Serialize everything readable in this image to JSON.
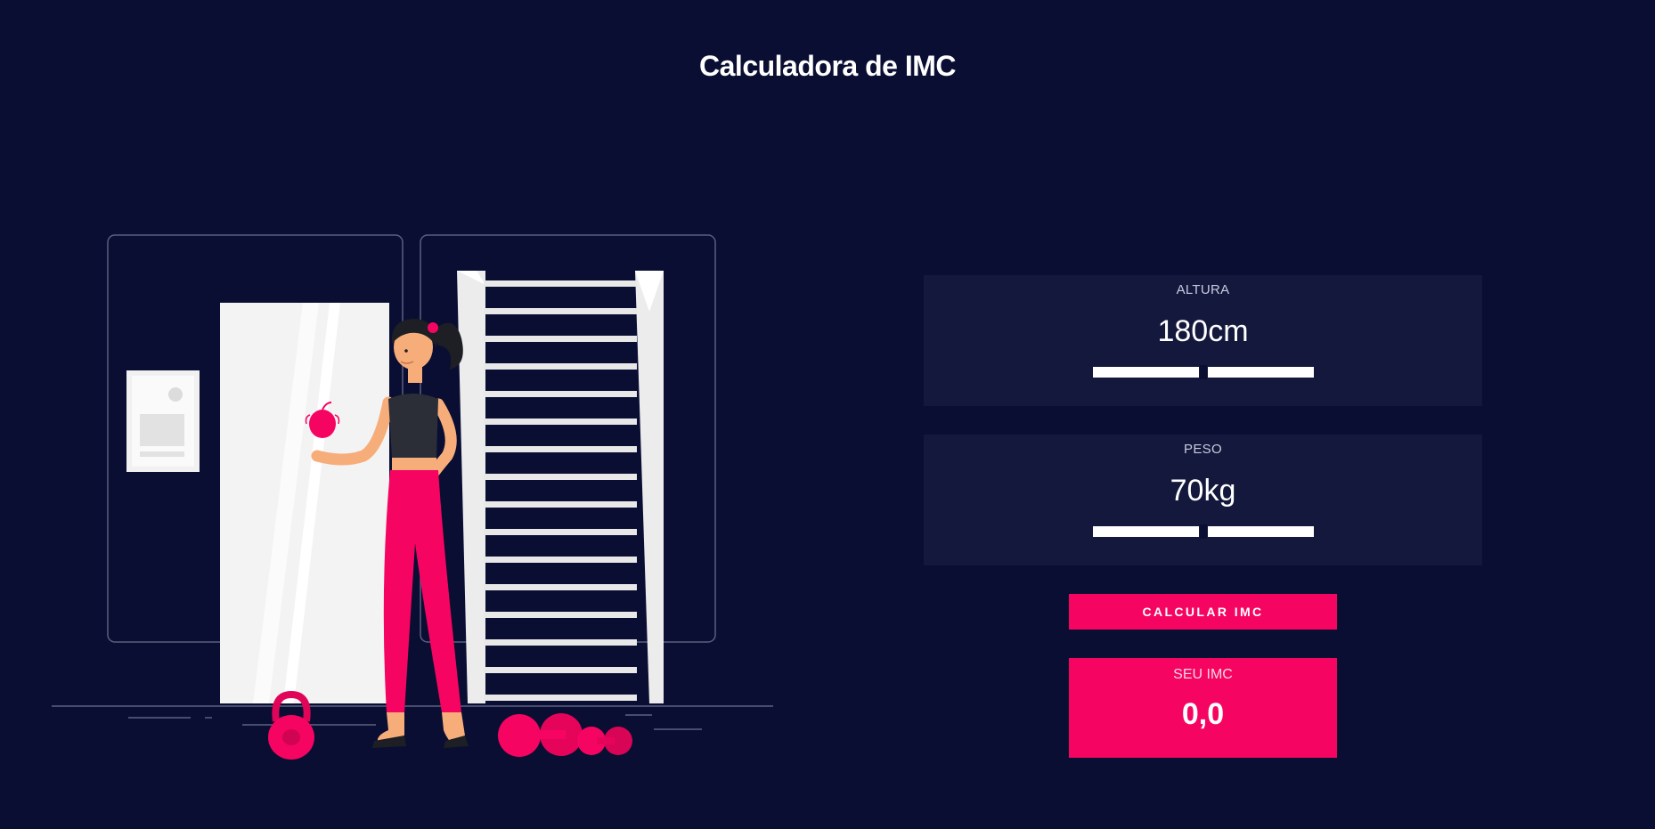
{
  "header": {
    "title": "Calculadora de IMC"
  },
  "form": {
    "height": {
      "label": "ALTURA",
      "value": "180cm",
      "slider_level": 0.5
    },
    "weight": {
      "label": "PESO",
      "value": "70kg",
      "slider_level": 0.5
    },
    "calculate_label": "CALCULAR IMC"
  },
  "result": {
    "label": "SEU IMC",
    "value": "0,0"
  },
  "colors": {
    "background": "#0a0e33",
    "panel": "#14183c",
    "accent": "#f50561",
    "text": "#ffffff"
  },
  "icons": {
    "illustration": "woman-at-gym-with-apple-illustration"
  }
}
